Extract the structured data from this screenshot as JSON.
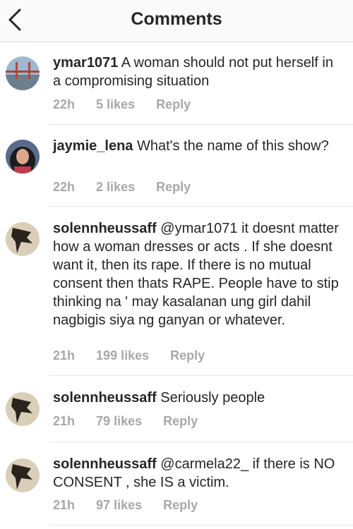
{
  "header": {
    "title": "Comments"
  },
  "comments": [
    {
      "username": "ymar1071",
      "text": "A woman should not put herself in a compromising situation",
      "time": "22h",
      "likes": "5 likes",
      "reply": "Reply"
    },
    {
      "username": "jaymie_lena",
      "text": "What's the name of this show?",
      "time": "22h",
      "likes": "2 likes",
      "reply": "Reply"
    },
    {
      "username": "solennheussaff",
      "mention": "@ymar1071",
      "text": "it doesnt matter how a woman dresses or acts . If she doesnt want it, then its rape. If there is no mutual consent then thats RAPE. People have to stip thinking na ' may kasalanan ung girl dahil nagbigis siya ng ganyan or whatever.",
      "time": "21h",
      "likes": "199 likes",
      "reply": "Reply"
    },
    {
      "username": "solennheussaff",
      "text": "Seriously people",
      "time": "21h",
      "likes": "79 likes",
      "reply": "Reply"
    },
    {
      "username": "solennheussaff",
      "mention": "@carmela22_",
      "text": "if there is NO CONSENT , she IS a victim.",
      "time": "21h",
      "likes": "97 likes",
      "reply": "Reply"
    }
  ]
}
